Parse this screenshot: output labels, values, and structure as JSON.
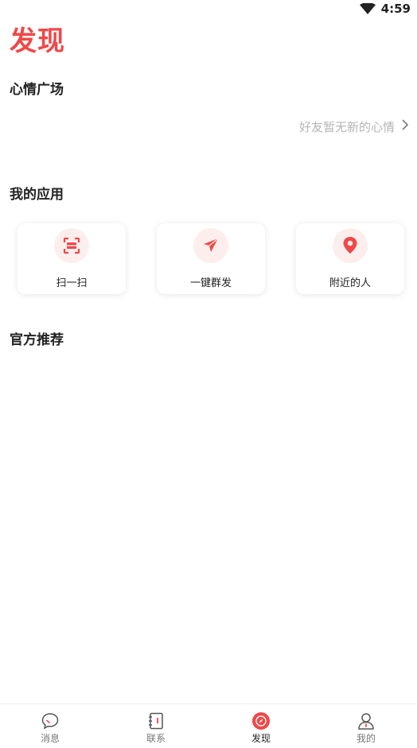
{
  "status_bar": {
    "time": "4:59",
    "wifi_icon": "wifi-icon"
  },
  "page": {
    "title": "发现"
  },
  "mood_plaza": {
    "title": "心情广场",
    "empty_text": "好友暂无新的心情",
    "arrow_icon": "chevron-right-icon"
  },
  "my_apps": {
    "title": "我的应用",
    "items": [
      {
        "label": "扫一扫",
        "icon": "scan-icon"
      },
      {
        "label": "一键群发",
        "icon": "send-icon"
      },
      {
        "label": "附近的人",
        "icon": "location-pin-icon"
      }
    ]
  },
  "official": {
    "title": "官方推荐"
  },
  "tabbar": {
    "items": [
      {
        "label": "消息",
        "icon": "message-icon"
      },
      {
        "label": "联系",
        "icon": "contacts-icon"
      },
      {
        "label": "发现",
        "icon": "compass-icon"
      },
      {
        "label": "我的",
        "icon": "profile-icon"
      }
    ],
    "active": "发现"
  },
  "colors": {
    "accent": "#f04848",
    "muted_text": "#b5b5b5",
    "icon_bg": "#fdeeee"
  }
}
